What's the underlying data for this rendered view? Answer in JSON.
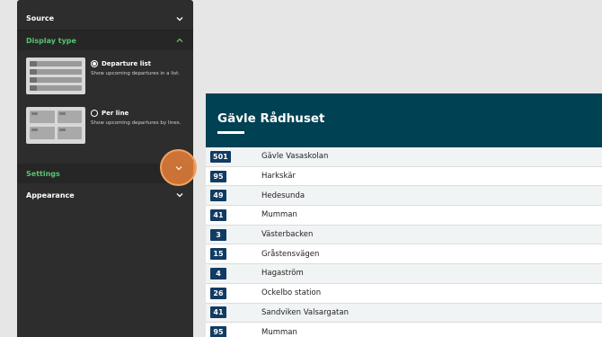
{
  "sidebar": {
    "source_label": "Source",
    "display_type_label": "Display type",
    "options": [
      {
        "title": "Departure list",
        "desc": "Show upcoming departures in a list.",
        "selected": true
      },
      {
        "title": "Per line",
        "desc": "Show upcoming departures by lines.",
        "selected": false
      }
    ],
    "settings_label": "Settings",
    "appearance_label": "Appearance"
  },
  "board": {
    "title": "Gävle Rådhuset",
    "rows": [
      {
        "line": "501",
        "dest": "Gävle Vasaskolan"
      },
      {
        "line": "95",
        "dest": "Harkskär"
      },
      {
        "line": "49",
        "dest": "Hedesunda"
      },
      {
        "line": "41",
        "dest": "Mumman"
      },
      {
        "line": "3",
        "dest": "Västerbacken"
      },
      {
        "line": "15",
        "dest": "Gråstensvägen"
      },
      {
        "line": "4",
        "dest": "Hagaström"
      },
      {
        "line": "26",
        "dest": "Ockelbo station"
      },
      {
        "line": "41",
        "dest": "Sandviken Valsargatan"
      },
      {
        "line": "95",
        "dest": "Mumman"
      }
    ]
  },
  "colors": {
    "accent": "#58c46f",
    "board_header": "#004153",
    "badge": "#123b63",
    "highlight": "#e9803a"
  }
}
